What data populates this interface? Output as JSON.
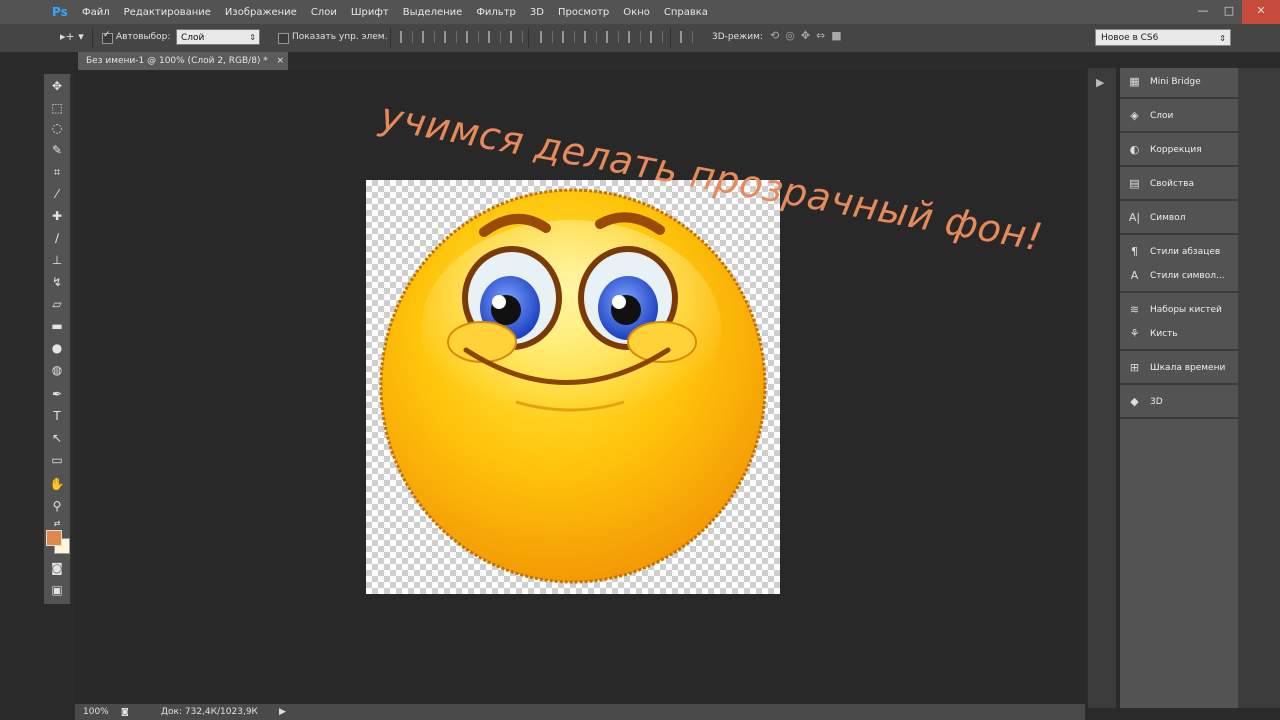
{
  "app": {
    "logo": "Ps"
  },
  "menubar": {
    "items": [
      "Файл",
      "Редактирование",
      "Изображение",
      "Слои",
      "Шрифт",
      "Выделение",
      "Фильтр",
      "3D",
      "Просмотр",
      "Окно",
      "Справка"
    ]
  },
  "window_controls": {
    "minimize": "—",
    "maximize": "□",
    "close": "✕"
  },
  "options": {
    "tool_indicator": "▸+ ▾",
    "autoselect_label": "Автовыбор:",
    "autoselect_value": "Слой",
    "show_transform_label": "Показать упр. элем.",
    "mode3d_label": "3D-режим:",
    "workspace": "Новое в CS6"
  },
  "document": {
    "tab_title": "Без имени-1 @ 100% (Слой 2, RGB/8) *",
    "tab_close": "×",
    "overlay_text": "учимся делать прозрачный фон!"
  },
  "status": {
    "zoom": "100%",
    "doc": "Док: 732,4К/1023,9К"
  },
  "panels": {
    "items": [
      {
        "label": "Mini Bridge",
        "icon": "mini-bridge-icon"
      },
      {
        "label": "Слои",
        "icon": "layers-icon"
      },
      {
        "label": "Коррекция",
        "icon": "adjustments-icon"
      },
      {
        "label": "Свойства",
        "icon": "properties-icon"
      },
      {
        "label": "Символ",
        "icon": "character-icon"
      },
      {
        "label": "Стили абзацев",
        "icon": "paragraph-styles-icon"
      },
      {
        "label": "Стили символ...",
        "icon": "character-styles-icon"
      },
      {
        "label": "Наборы кистей",
        "icon": "brush-presets-icon"
      },
      {
        "label": "Кисть",
        "icon": "brush-icon"
      },
      {
        "label": "Шкала времени",
        "icon": "timeline-icon"
      },
      {
        "label": "3D",
        "icon": "3d-icon"
      }
    ]
  },
  "colors": {
    "foreground": "#e08a4a",
    "background": "#fff6d9",
    "overlay_text": "#e8895a"
  }
}
